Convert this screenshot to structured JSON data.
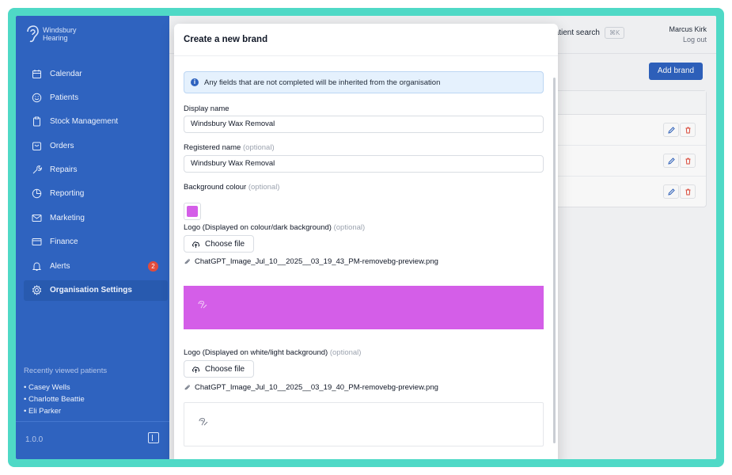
{
  "brand": {
    "line1": "Windsbury",
    "line2": "Hearing"
  },
  "sidebar": {
    "items": [
      {
        "label": "Calendar",
        "icon": "calendar-icon"
      },
      {
        "label": "Patients",
        "icon": "smile-icon"
      },
      {
        "label": "Stock Management",
        "icon": "clipboard-icon"
      },
      {
        "label": "Orders",
        "icon": "inbox-icon"
      },
      {
        "label": "Repairs",
        "icon": "wrench-icon"
      },
      {
        "label": "Reporting",
        "icon": "pie-chart-icon"
      },
      {
        "label": "Marketing",
        "icon": "mail-icon"
      },
      {
        "label": "Finance",
        "icon": "credit-card-icon"
      },
      {
        "label": "Alerts",
        "icon": "bell-icon",
        "badge": "2"
      },
      {
        "label": "Organisation Settings",
        "icon": "gear-icon",
        "active": true
      }
    ],
    "recent_title": "Recently viewed patients",
    "recent": [
      "• Casey Wells",
      "• Charlotte Beattie",
      "• Eli Parker"
    ],
    "version": "1.0.0"
  },
  "header": {
    "search_label": "Patient search",
    "search_shortcut": "⌘K",
    "user_name": "Marcus Kirk",
    "logout": "Log out"
  },
  "page": {
    "add_brand_label": "Add brand"
  },
  "modal": {
    "title": "Create a new brand",
    "info": "Any fields that are not completed will be inherited from the organisation",
    "display_name_label": "Display name",
    "display_name_value": "Windsbury Wax Removal",
    "registered_name_label": "Registered name",
    "registered_name_value": "Windsbury Wax Removal",
    "background_colour_label": "Background colour",
    "background_colour_value": "#d45ee8",
    "optional": "(optional)",
    "logo_dark_label": "Logo (Displayed on colour/dark background)",
    "logo_light_label": "Logo (Displayed on white/light background)",
    "choose_file": "Choose file",
    "logo_dark_file": "ChatGPT_Image_Jul_10__2025__03_19_43_PM-removebg-preview.png",
    "logo_light_file": "ChatGPT_Image_Jul_10__2025__03_19_40_PM-removebg-preview.png"
  },
  "colors": {
    "sidebar": "#2f63bf",
    "accent": "#2f63bf",
    "brand_swatch": "#d45ee8",
    "frame": "#4fd9c6"
  }
}
